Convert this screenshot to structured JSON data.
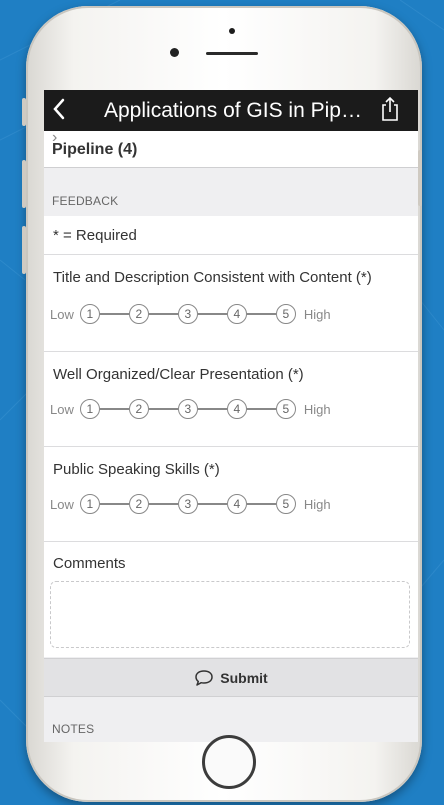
{
  "nav": {
    "title": "Applications of GIS in Pip…",
    "back_icon": "chevron-left-icon",
    "share_icon": "share-icon"
  },
  "pipeline": {
    "label": "Pipeline (4)"
  },
  "feedback": {
    "section_label": "FEEDBACK",
    "required_note": "* = Required",
    "questions": [
      {
        "label": "Title and Description Consistent with Content (*)"
      },
      {
        "label": "Well Organized/Clear Presentation (*)"
      },
      {
        "label": "Public Speaking Skills (*)"
      }
    ],
    "scale": {
      "low": "Low",
      "high": "High",
      "options": [
        "1",
        "2",
        "3",
        "4",
        "5"
      ]
    },
    "comments_label": "Comments",
    "comments_value": "",
    "submit_label": "Submit"
  },
  "notes": {
    "section_label": "NOTES"
  },
  "colors": {
    "background": "#1f7fc4",
    "navbar": "#1b1b1b"
  }
}
